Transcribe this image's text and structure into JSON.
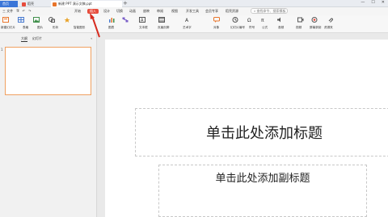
{
  "tabs": [
    {
      "label": "首页"
    },
    {
      "label": "稻壳"
    },
    {
      "label": "新建 PPT 演示文稿.ppt"
    }
  ],
  "menu": {
    "file": "三 文件",
    "items": [
      "开始",
      "插入",
      "设计",
      "切换",
      "动画",
      "放映",
      "审阅",
      "视图",
      "开发工具",
      "会员专享",
      "稻壳资源"
    ],
    "search": "查找命令、搜索模板"
  },
  "ribbon": {
    "new_slide": "新建幻灯片",
    "table": "表格",
    "picture": "图片",
    "shape": "形状",
    "icon": "图标",
    "smart_art": "智能图形",
    "chart": "图表",
    "textbox": "文本框",
    "wordart": "艺术字",
    "comment": "批注",
    "header_footer": "页眉页脚",
    "slide_number": "幻灯片编号",
    "symbol": "符号",
    "formula": "公式",
    "video": "视频",
    "audio": "音频",
    "screen_record": "屏幕录制",
    "more": "资源夹",
    "object": "对象",
    "ink": "超链接",
    "row2": [
      "新建幻灯片",
      "表格",
      "图片",
      "形状",
      "图标",
      "智能图形",
      "流程图",
      "思维导图",
      "截屏",
      "屏幕录制",
      "批注",
      "页眉页脚",
      "日期和时间",
      "艺术字",
      "对象",
      "超链接",
      "公式",
      "音频",
      "视频",
      "幻灯片",
      "附件"
    ]
  },
  "view_tabs": [
    "大纲",
    "幻灯片"
  ],
  "slide_number": "1",
  "slide": {
    "title_placeholder": "单击此处添加标题",
    "subtitle_placeholder": "单击此处添加副标题"
  }
}
